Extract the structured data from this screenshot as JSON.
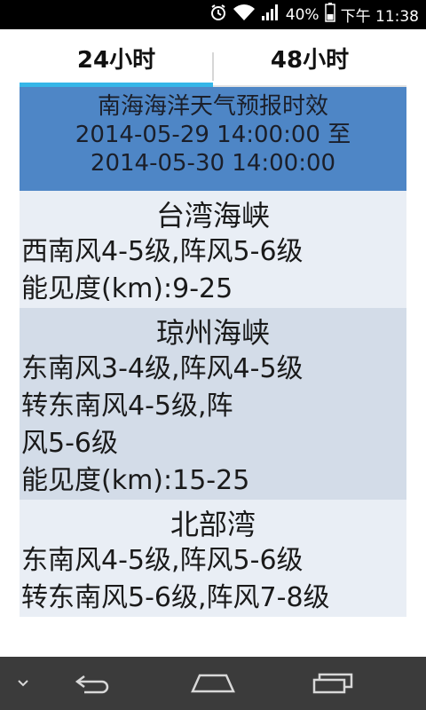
{
  "status_bar": {
    "battery_percent": "40%",
    "time": "下午 11:38"
  },
  "tabs": [
    {
      "label": "24小时",
      "active": true
    },
    {
      "label": "48小时",
      "active": false
    }
  ],
  "forecast_header": {
    "line1": "南海海洋天气预报时效",
    "line2": "2014-05-29 14:00:00 至",
    "line3": "2014-05-30 14:00:00"
  },
  "regions": [
    {
      "name": "台湾海峡",
      "lines": [
        "西南风4-5级,阵风5-6级",
        "能见度(km):9-25"
      ]
    },
    {
      "name": "琼州海峡",
      "lines": [
        "东南风3-4级,阵风4-5级",
        "转东南风4-5级,阵",
        "风5-6级",
        "能见度(km):15-25"
      ]
    },
    {
      "name": "北部湾",
      "lines": [
        "东南风4-5级,阵风5-6级",
        "转东南风5-6级,阵风7-8级"
      ]
    }
  ],
  "colors": {
    "header_bg": "#4e86c6",
    "tab_indicator": "#35b6e8",
    "row_light": "#e9eef5",
    "row_dark": "#d3dce8"
  },
  "icons": {
    "status": [
      "alarm-icon",
      "wifi-icon",
      "signal-icon",
      "battery-icon"
    ],
    "nav": [
      "chevron-down-icon",
      "back-icon",
      "home-icon",
      "recents-icon"
    ]
  }
}
